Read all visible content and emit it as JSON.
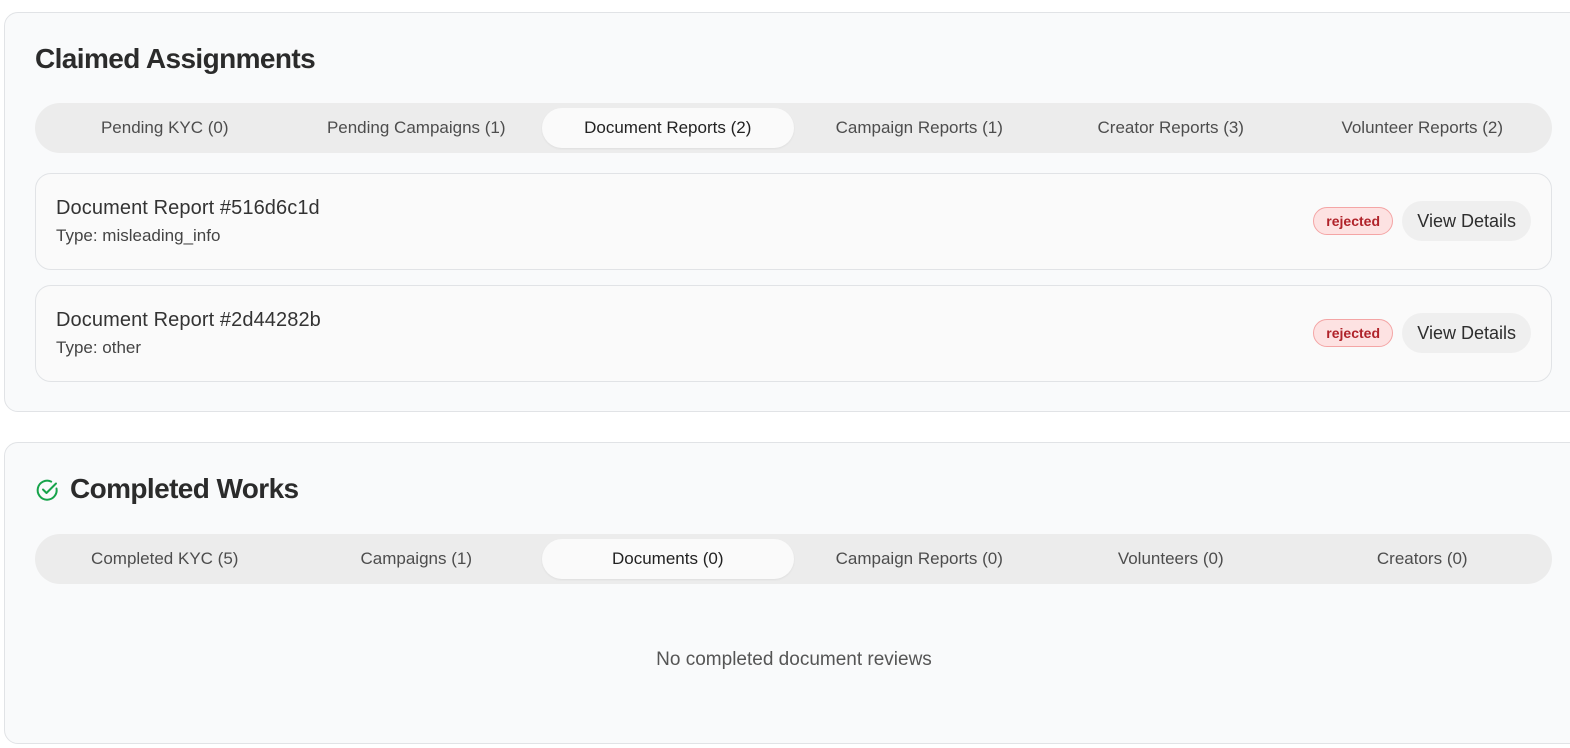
{
  "claimed": {
    "title": "Claimed Assignments",
    "tabs": [
      {
        "label": "Pending KYC (0)",
        "active": false
      },
      {
        "label": "Pending Campaigns (1)",
        "active": false
      },
      {
        "label": "Document Reports (2)",
        "active": true
      },
      {
        "label": "Campaign Reports (1)",
        "active": false
      },
      {
        "label": "Creator Reports (3)",
        "active": false
      },
      {
        "label": "Volunteer Reports (2)",
        "active": false
      }
    ],
    "reports": [
      {
        "title": "Document Report #516d6c1d",
        "type": "Type: misleading_info",
        "status": "rejected",
        "action": "View Details"
      },
      {
        "title": "Document Report #2d44282b",
        "type": "Type: other",
        "status": "rejected",
        "action": "View Details"
      }
    ]
  },
  "completed": {
    "title": "Completed Works",
    "icon": "check-circle-icon",
    "tabs": [
      {
        "label": "Completed KYC (5)",
        "active": false
      },
      {
        "label": "Campaigns (1)",
        "active": false
      },
      {
        "label": "Documents (0)",
        "active": true
      },
      {
        "label": "Campaign Reports (0)",
        "active": false
      },
      {
        "label": "Volunteers (0)",
        "active": false
      },
      {
        "label": "Creators (0)",
        "active": false
      }
    ],
    "empty_message": "No completed document reviews"
  },
  "colors": {
    "success_green": "#16a34a",
    "badge_bg": "#fde2e2",
    "badge_text": "#b0232a",
    "badge_border": "#f4a5a5"
  }
}
